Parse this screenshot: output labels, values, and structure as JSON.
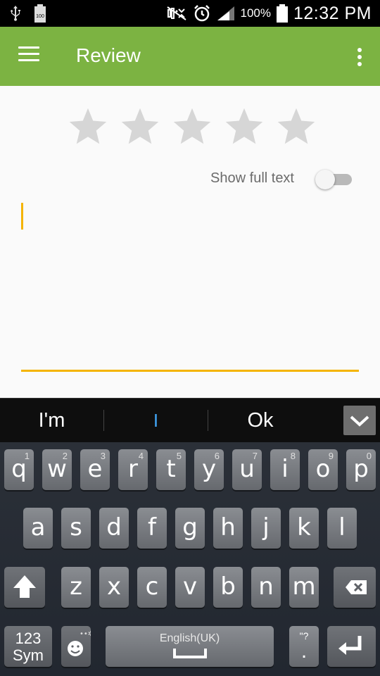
{
  "status_bar": {
    "battery_percent": "100%",
    "time": "12:32 PM",
    "left_icons": [
      "usb-icon",
      "battery-100-icon"
    ],
    "right_icons": [
      "mute-icon",
      "alarm-icon",
      "signal-icon",
      "battery-icon"
    ],
    "battery_small_label": "100"
  },
  "app_bar": {
    "title": "Review",
    "color": "#7cb342"
  },
  "rating": {
    "stars_total": 5,
    "stars_selected": 0
  },
  "toggle": {
    "label": "Show full text",
    "on": false
  },
  "review_text": {
    "value": "",
    "accent_color": "#f4b400"
  },
  "suggestions": [
    "I'm",
    "I",
    "Ok"
  ],
  "keyboard": {
    "row1": [
      {
        "key": "q",
        "num": "1"
      },
      {
        "key": "w",
        "num": "2"
      },
      {
        "key": "e",
        "num": "3"
      },
      {
        "key": "r",
        "num": "4"
      },
      {
        "key": "t",
        "num": "5"
      },
      {
        "key": "y",
        "num": "6"
      },
      {
        "key": "u",
        "num": "7"
      },
      {
        "key": "i",
        "num": "8"
      },
      {
        "key": "o",
        "num": "9"
      },
      {
        "key": "p",
        "num": "0"
      }
    ],
    "row2": [
      "a",
      "s",
      "d",
      "f",
      "g",
      "h",
      "j",
      "k",
      "l"
    ],
    "row3": [
      "z",
      "x",
      "c",
      "v",
      "b",
      "n",
      "m"
    ],
    "sym_label_1": "123",
    "sym_label_2": "Sym",
    "space_label": "English(UK)",
    "period_label": ".",
    "period_sup": "\"?"
  }
}
